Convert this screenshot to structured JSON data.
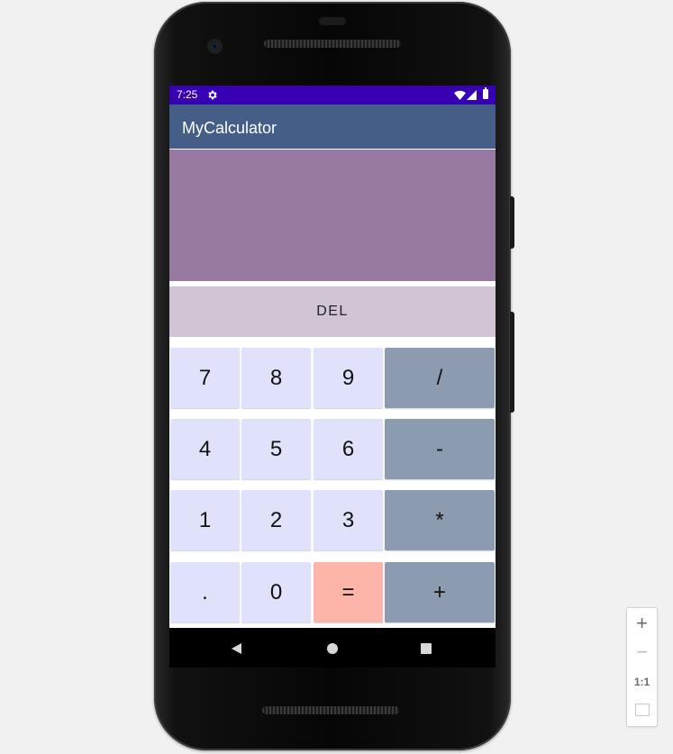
{
  "status_bar": {
    "time": "7:25",
    "settings_icon": "gear-icon",
    "wifi_icon": "wifi-icon",
    "signal_icon": "signal-icon",
    "battery_icon": "battery-icon",
    "color": "#3700b3"
  },
  "app_bar": {
    "title": "MyCalculator",
    "color": "#445e88"
  },
  "display": {
    "value": "",
    "color": "#98799f"
  },
  "del_button": {
    "label": "DEL",
    "color": "#d1c4d4"
  },
  "keypad": {
    "rows": [
      [
        "7",
        "8",
        "9",
        "/"
      ],
      [
        "4",
        "5",
        "6",
        "-"
      ],
      [
        "1",
        "2",
        "3",
        "*"
      ],
      [
        ".",
        "0",
        "=",
        "+"
      ]
    ],
    "colors": {
      "number": "#e0e2fb",
      "operator": "#8d9bb1",
      "equals": "#fdb5aa"
    }
  },
  "nav_bar": {
    "back_icon": "back-icon",
    "home_icon": "home-icon",
    "recents_icon": "recents-icon"
  },
  "zoom_controls": {
    "zoom_in": "+",
    "zoom_out": "−",
    "actual_size": "1:1",
    "fit_icon": "fit-screen-icon"
  }
}
